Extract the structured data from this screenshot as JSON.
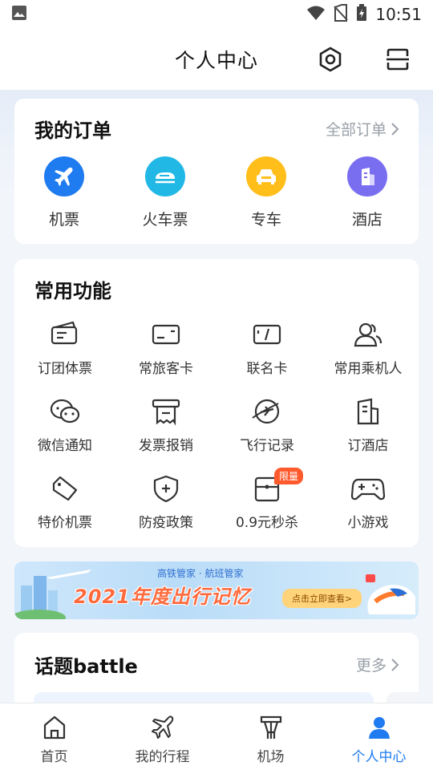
{
  "status_bar": {
    "time": "10:51"
  },
  "header": {
    "title": "个人中心"
  },
  "orders": {
    "title": "我的订单",
    "all_link": "全部订单",
    "items": [
      {
        "label": "机票",
        "icon": "plane-icon",
        "color": "#1e7bf0"
      },
      {
        "label": "火车票",
        "icon": "train-icon",
        "color": "#22b8e6"
      },
      {
        "label": "专车",
        "icon": "car-icon",
        "color": "#ffbe1a"
      },
      {
        "label": "酒店",
        "icon": "hotel-icon",
        "color": "#7a6ef0"
      }
    ]
  },
  "functions": {
    "title": "常用功能",
    "items": [
      {
        "label": "订团体票",
        "icon": "group-ticket-icon"
      },
      {
        "label": "常旅客卡",
        "icon": "frequent-flyer-card-icon"
      },
      {
        "label": "联名卡",
        "icon": "co-branded-card-icon"
      },
      {
        "label": "常用乘机人",
        "icon": "passenger-icon"
      },
      {
        "label": "微信通知",
        "icon": "wechat-icon"
      },
      {
        "label": "发票报销",
        "icon": "invoice-icon"
      },
      {
        "label": "飞行记录",
        "icon": "flight-record-icon"
      },
      {
        "label": "订酒店",
        "icon": "book-hotel-icon"
      },
      {
        "label": "特价机票",
        "icon": "discount-ticket-icon"
      },
      {
        "label": "防疫政策",
        "icon": "shield-icon"
      },
      {
        "label": "0.9元秒杀",
        "icon": "flash-sale-icon",
        "badge": "限量"
      },
      {
        "label": "小游戏",
        "icon": "gamepad-icon"
      }
    ]
  },
  "banner": {
    "brand": "高铁管家 · 航班管家",
    "title": "2021年度出行记忆",
    "cta": "点击立即查看>"
  },
  "topics": {
    "title": "话题battle",
    "more": "更多"
  },
  "bottom_nav": {
    "items": [
      {
        "label": "首页",
        "icon": "home-icon"
      },
      {
        "label": "我的行程",
        "icon": "trip-icon"
      },
      {
        "label": "机场",
        "icon": "airport-icon"
      },
      {
        "label": "个人中心",
        "icon": "profile-icon",
        "active": true
      }
    ]
  },
  "colors": {
    "accent": "#1e7bf0",
    "badge": "#ff5a2c"
  }
}
